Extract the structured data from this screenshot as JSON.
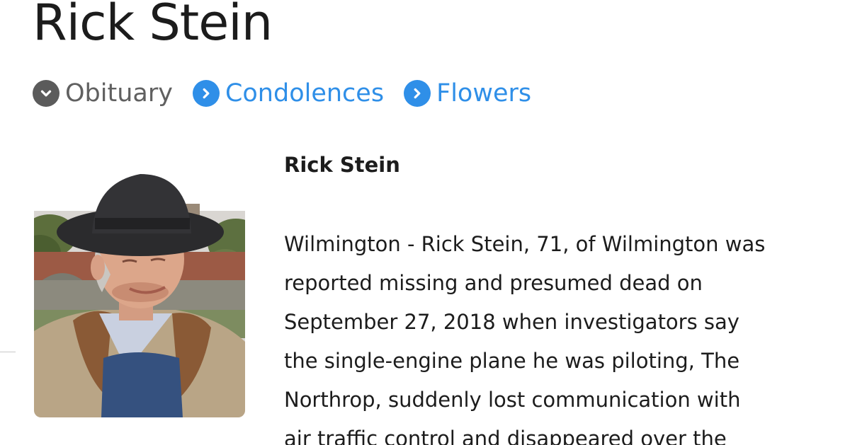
{
  "page": {
    "title": "Rick Stein"
  },
  "tabs": [
    {
      "label": "Obituary",
      "icon": "chevron-down-icon",
      "state": "active",
      "color": "#5b5b5b"
    },
    {
      "label": "Condolences",
      "icon": "chevron-right-icon",
      "state": "link",
      "color": "#2f8fe8"
    },
    {
      "label": "Flowers",
      "icon": "chevron-right-icon",
      "state": "link",
      "color": "#2f8fe8"
    }
  ],
  "obituary": {
    "name": "Rick Stein",
    "lines": [
      "Wilmington - Rick Stein, 71, of Wilmington was",
      "reported missing and presumed dead on",
      "September 27, 2018 when investigators say",
      "the single-engine plane he was piloting, The",
      "Northrop, suddenly lost communication with",
      "air traffic control and disappeared over the"
    ]
  },
  "photo": {
    "description_icon": "portrait-photo"
  }
}
